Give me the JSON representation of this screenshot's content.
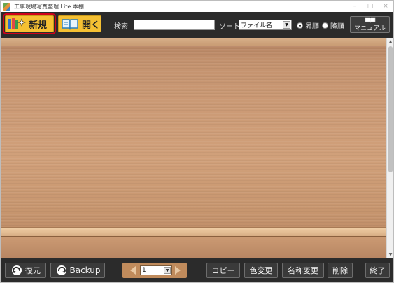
{
  "window": {
    "title": "工事現場写真整理 Lite 本棚",
    "controls": [
      "–",
      "□",
      "×"
    ]
  },
  "toolbar": {
    "new_label": "新規",
    "open_label": "開く",
    "search_label": "検索",
    "search_value": "",
    "sort_label": "ソート",
    "sort_value": "ファイル名",
    "order_asc_label": "昇順",
    "order_desc_label": "降順",
    "order_selected": "asc",
    "manual_label": "マニュアル"
  },
  "bottombar": {
    "restore_label": "復元",
    "backup_label": "Backup",
    "page_value": "1",
    "copy_label": "コピー",
    "color_change_label": "色変更",
    "rename_label": "名称変更",
    "delete_label": "削除",
    "close_label": "終了"
  },
  "icons": {
    "new": "books-sparkle-icon",
    "open": "open-book-icon",
    "manual": "book-icon",
    "restore": "restore-arrow-icon",
    "backup": "backup-arrow-icon"
  },
  "colors": {
    "toolbar_bg": "#2b2b2b",
    "accent_button": "#f5c033",
    "highlight_outline": "#d0021b",
    "shelf_wood": "#c9976f"
  }
}
